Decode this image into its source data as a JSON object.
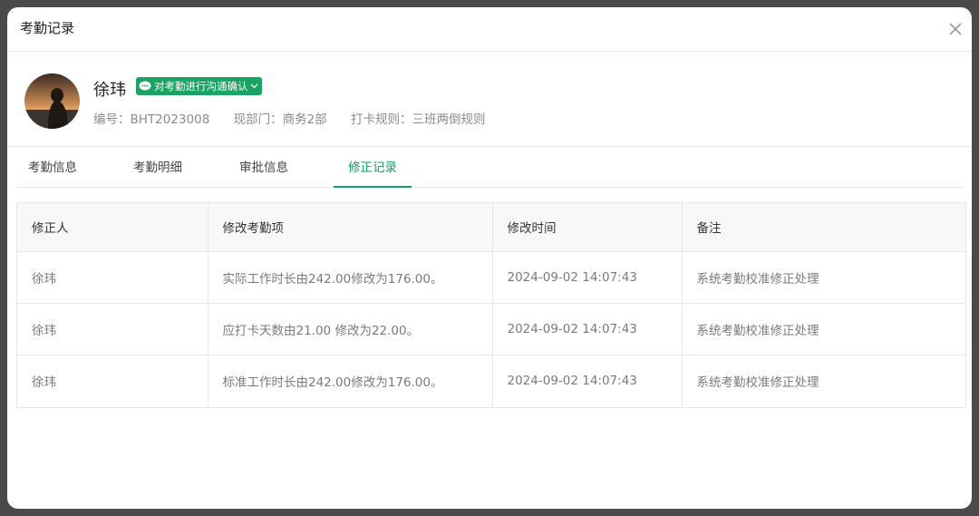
{
  "modal": {
    "title": "考勤记录"
  },
  "profile": {
    "name": "徐玮",
    "badge_label": "对考勤进行沟通确认",
    "employee_no": "编号：BHT2023008",
    "department": "现部门：商务2部",
    "clock_rule": "打卡规则：三班两倒规则"
  },
  "tabs": [
    {
      "label": "考勤信息"
    },
    {
      "label": "考勤明细"
    },
    {
      "label": "审批信息"
    },
    {
      "label": "修正记录"
    }
  ],
  "table": {
    "headers": [
      "修正人",
      "修改考勤项",
      "修改时间",
      "备注"
    ],
    "rows": [
      [
        "徐玮",
        "实际工作时长由242.00修改为176.00。",
        "2024-09-02 14:07:43",
        "系统考勤校准修正处理"
      ],
      [
        "徐玮",
        "应打卡天数由21.00 修改为22.00。",
        "2024-09-02 14:07:43",
        "系统考勤校准修正处理"
      ],
      [
        "徐玮",
        "标准工作时长由242.00修改为176.00。",
        "2024-09-02 14:07:43",
        "系统考勤校准修正处理"
      ]
    ]
  },
  "icons": {
    "close": "close-icon",
    "wechat": "wechat-bubble-icon",
    "chevron": "chevron-down-icon"
  },
  "colors": {
    "accent": "#14a06a",
    "badge": "#1aa362"
  }
}
